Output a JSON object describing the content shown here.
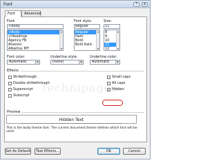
{
  "window": {
    "title": "Font",
    "help": "?",
    "close": "x"
  },
  "tabs": [
    {
      "label": "Font"
    },
    {
      "label": "Advanced"
    }
  ],
  "font": {
    "label": "Font:",
    "value": "+Body",
    "items": [
      "+Body",
      "+Headings",
      "Agency FB",
      "Aharoni",
      "Albertus MT"
    ],
    "selected_index": 0
  },
  "font_style": {
    "label": "Font style:",
    "value": "Regular",
    "items": [
      "Regular",
      "Italic",
      "Bold",
      "Bold Italic"
    ],
    "selected_index": 0
  },
  "size": {
    "label": "Size:",
    "value": "11",
    "items": [
      "8",
      "9",
      "10",
      "11",
      "12"
    ],
    "selected_index": 3
  },
  "font_color": {
    "label": "Font color:",
    "value": "Automatic"
  },
  "underline_style": {
    "label": "Underline style:",
    "value": "(none)"
  },
  "underline_color": {
    "label": "Underline color:",
    "value": "Automatic"
  },
  "effects": {
    "label": "Effects",
    "left": [
      {
        "label": "Strikethrough",
        "checked": false
      },
      {
        "label": "Double strikethrough",
        "checked": false
      },
      {
        "label": "Superscript",
        "checked": false
      },
      {
        "label": "Subscript",
        "checked": false
      }
    ],
    "right": [
      {
        "label": "Small caps",
        "checked": false
      },
      {
        "label": "All caps",
        "checked": false
      },
      {
        "label": "Hidden",
        "checked": true
      }
    ]
  },
  "watermark": "technipages",
  "preview": {
    "label": "Preview",
    "text": "Hidden Text",
    "description": "This is the body theme font. The current document theme defines which font will be used."
  },
  "buttons": {
    "set_default": "Set As Default",
    "text_effects": "Text Effects...",
    "ok": "OK",
    "cancel": "Cancel"
  },
  "colors": {
    "highlight": "#d02020",
    "selection": "#3399ff"
  }
}
